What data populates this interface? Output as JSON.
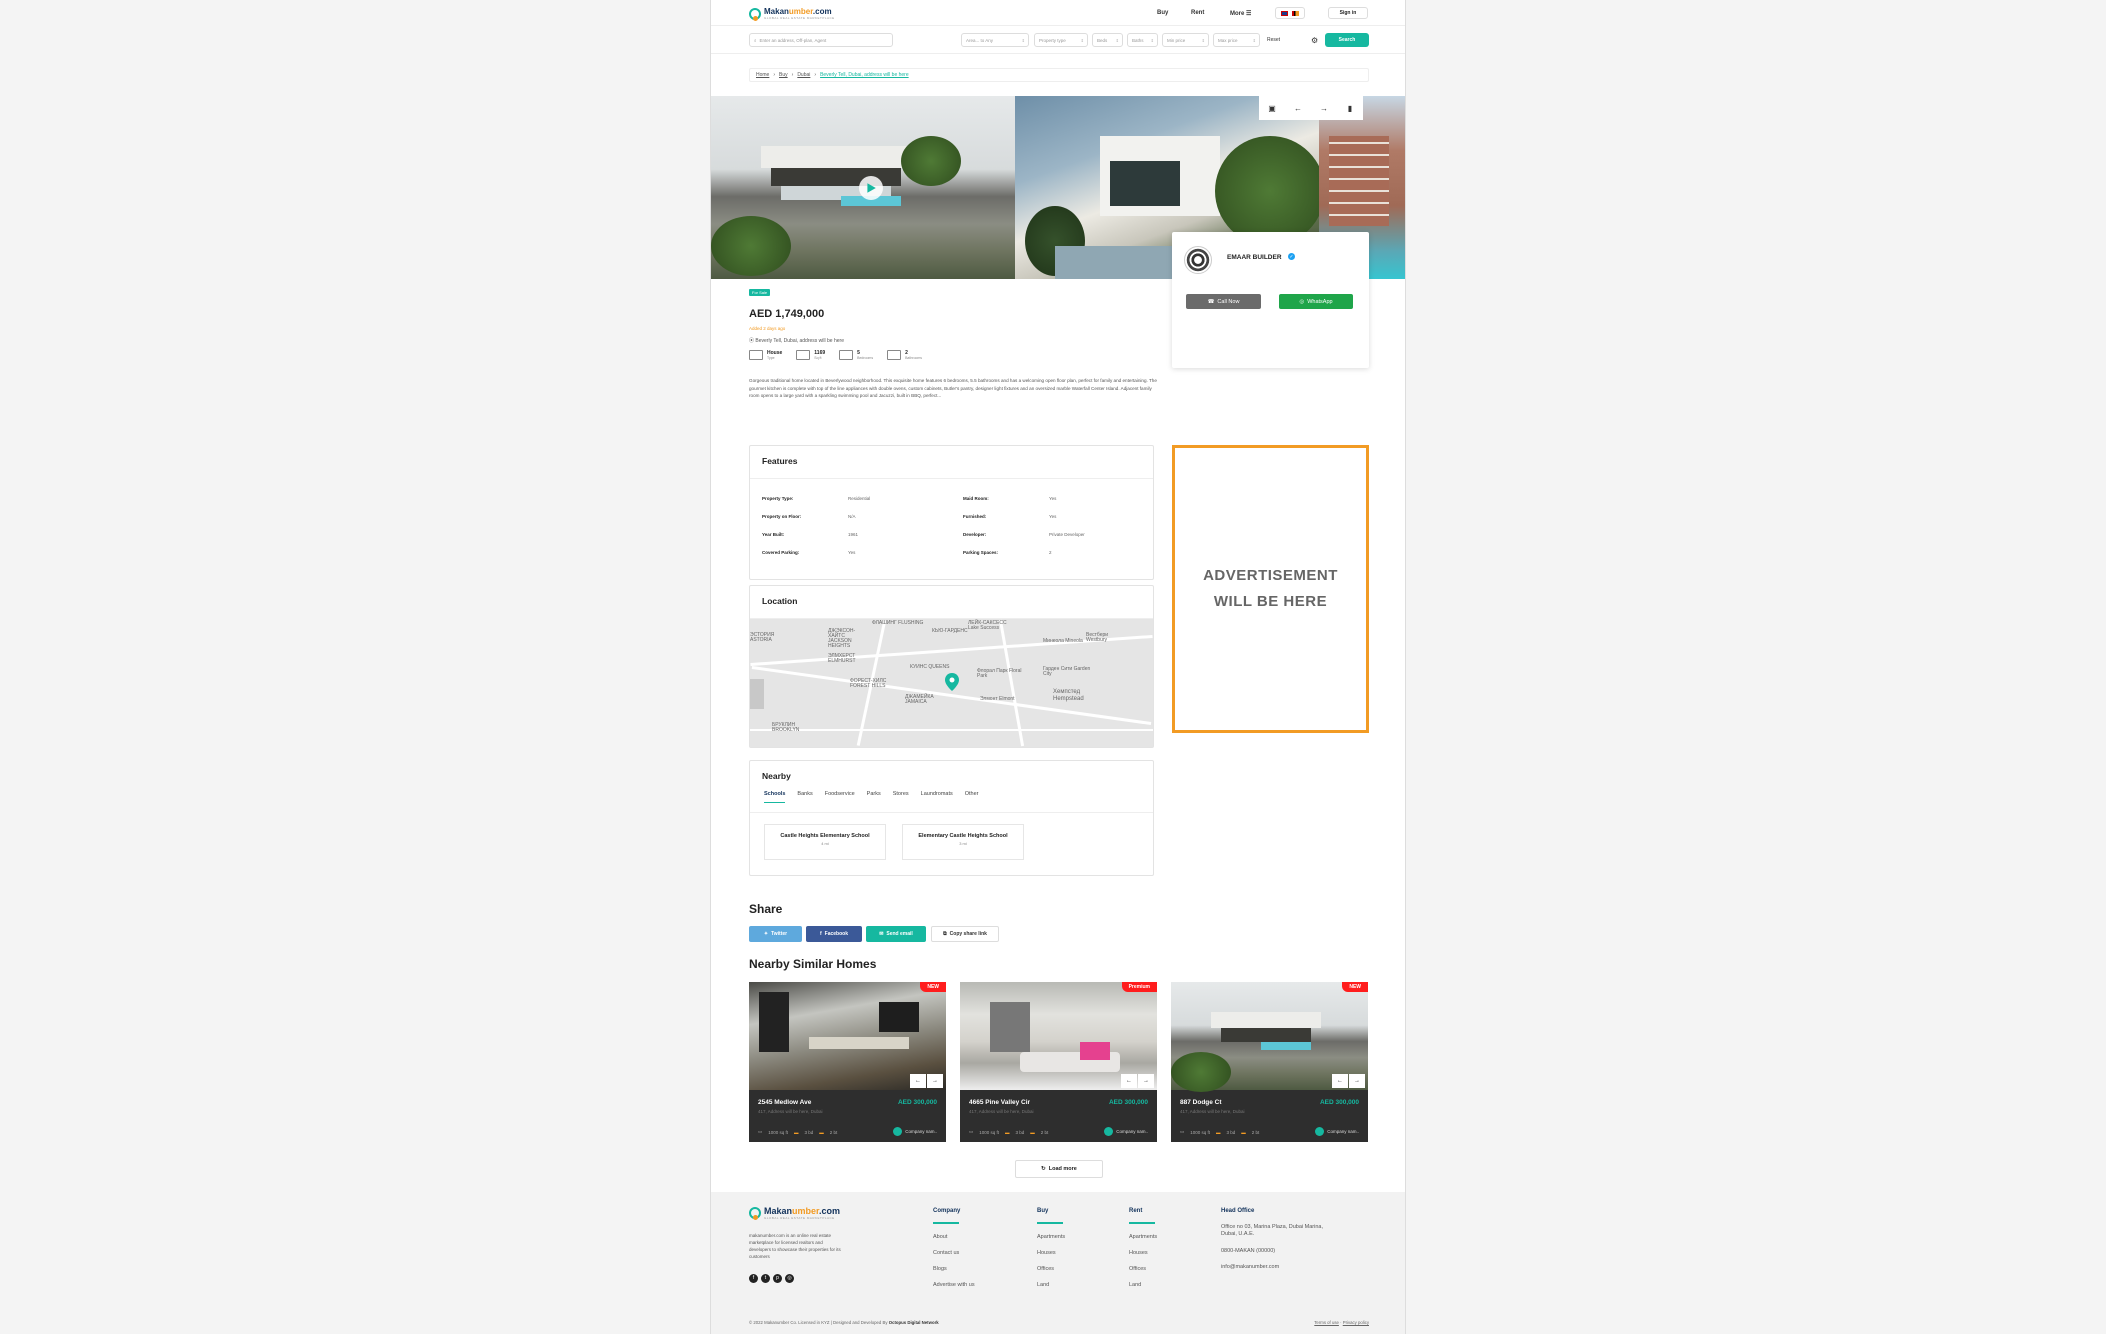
{
  "brand": {
    "name_part1": "Makan",
    "name_part2": "umber",
    "name_suffix": ".com",
    "tagline": "GLOBAL REAL ESTATE MARKETPLACE",
    "colors": {
      "teal": "#16b8a0",
      "orange": "#f29b24",
      "navy": "#12325b"
    }
  },
  "header": {
    "nav": [
      "Buy",
      "Rent",
      "More"
    ],
    "lang_flags": [
      "uk-flag-icon",
      "uae-flag-icon"
    ],
    "signin_label": "Sign in"
  },
  "search": {
    "placeholder": "Enter an address, Off-plan, Agent",
    "area": "Area...   to  Any",
    "property_type": "Property type",
    "beds": "Beds",
    "baths": "Baths",
    "min_price": "Min price",
    "max_price": "Max price",
    "reset_label": "Reset",
    "search_label": "Search"
  },
  "breadcrumb": [
    "Home",
    "Buy",
    "Dubai",
    "Beverly Tell, Dubai, address will be here"
  ],
  "agent": {
    "name": "EMAAR BUILDER",
    "call_label": "Call Now",
    "whatsapp_label": "WhatsApp"
  },
  "listing": {
    "status": "For Sale",
    "price": "AED 1,749,000",
    "posted": "Added 2 days ago",
    "address": "Beverly Tell, Dubai, address will be here",
    "specs": [
      {
        "value": "House",
        "label": "Type",
        "icon": "house-icon"
      },
      {
        "value": "1169",
        "label": "Sq ft",
        "icon": "area-icon"
      },
      {
        "value": "5",
        "label": "Bedrooms",
        "icon": "bed-icon"
      },
      {
        "value": "2",
        "label": "Bathrooms",
        "icon": "bath-icon"
      }
    ],
    "description": "Gorgeous traditional home located in Beverlywood neighborhood. This exquisite home features 6 bedrooms, 5.5 bathrooms and has a welcoming open floor plan, perfect for family and entertaining. The gourmet kitchen is complete with top of the line appliances with double ovens, custom cabinets, Butler's pantry, designer light fixtures and an oversized marble Waterfall Center Island. Adjacent family room opens to a large yard with a sparkling swimming pool and Jacuzzi, built in BBQ, perfect..."
  },
  "features": {
    "title": "Features",
    "left": [
      {
        "k": "Property Type:",
        "v": "Residential"
      },
      {
        "k": "Property on Floor:",
        "v": "N/A"
      },
      {
        "k": "Year Built:",
        "v": "1961"
      },
      {
        "k": "Covered Parking:",
        "v": "Yes"
      }
    ],
    "right": [
      {
        "k": "Maid Room:",
        "v": "Yes"
      },
      {
        "k": "Furnished:",
        "v": "Yes"
      },
      {
        "k": "Developer:",
        "v": "Private Developer"
      },
      {
        "k": "Parking Spaces:",
        "v": "2"
      }
    ]
  },
  "location": {
    "title": "Location",
    "map_labels": [
      "ФЛАШИНГ FLUSHING",
      "ДЖЭКСОН-ХАЙТС JACKSON HEIGHTS",
      "ЭЛМХЕРСТ ELMHURST",
      "КЬЮ-ГАРДЕНС",
      "ЛЕЙК-САКСЕСС Lake Success",
      "Минеола Mineola",
      "Вестбери Westbury",
      "КУИНС QUEENS",
      "Флорал Парк Floral Park",
      "Гарден Сити Garden City",
      "ФОРЕСТ-ХИЛС FOREST HILLS",
      "ДЖАМЕЙКА JAMAICA",
      "Элмонт Elmont",
      "Хемпстед Hempstead",
      "БРУКЛИН BROOKLYN",
      "ЭСТОРИЯ ASTORIA"
    ]
  },
  "ad": {
    "line1": "ADVERTISEMENT",
    "line2": "WILL BE HERE"
  },
  "nearby": {
    "title": "Nearby",
    "tabs": [
      "Schools",
      "Banks",
      "Foodservice",
      "Parks",
      "Stores",
      "Laundromats",
      "Other"
    ],
    "items": [
      {
        "name": "Castle Heights Elementary School",
        "dist": "4 mi"
      },
      {
        "name": "Elementary Castle Heights School",
        "dist": "3 mi"
      }
    ]
  },
  "share": {
    "title": "Share",
    "twitter": "Twitter",
    "facebook": "Facebook",
    "email": "Send email",
    "copy": "Copy share link"
  },
  "similar": {
    "title": "Nearby Similar Homes",
    "cards": [
      {
        "badge": "NEW",
        "title": "2545 Medlow Ave",
        "price": "AED 300,000",
        "address": "417, Address will be here, Dubai",
        "sqft": "1000 sq ft",
        "beds": "3 bd",
        "baths": "2 bt",
        "company": "Company nam.."
      },
      {
        "badge": "Premium",
        "title": "4665 Pine Valley Cir",
        "price": "AED 300,000",
        "address": "417, Address will be here, Dubai",
        "sqft": "1000 sq ft",
        "beds": "3 bd",
        "baths": "2 bt",
        "company": "Company nam.."
      },
      {
        "badge": "NEW",
        "title": "887 Dodge Ct",
        "price": "AED 300,000",
        "address": "417, Address will be here, Dubai",
        "sqft": "1000 sq ft",
        "beds": "3 bd",
        "baths": "2 bt",
        "company": "Company nam.."
      }
    ],
    "load_more": "Load more"
  },
  "footer": {
    "about": "makanumber.com is an online real estate marketplace for licensed realtors and developers to showcase their properties for its customers",
    "company": {
      "title": "Company",
      "items": [
        "About",
        "Contact us",
        "Blogs",
        "Advertise with us"
      ]
    },
    "buy": {
      "title": "Buy",
      "items": [
        "Apartments",
        "Houses",
        "Offices",
        "Land"
      ]
    },
    "rent": {
      "title": "Rent",
      "items": [
        "Apartments",
        "Houses",
        "Offices",
        "Land"
      ]
    },
    "office": {
      "title": "Head Office",
      "address": "Office no 03, Marina Plaza, Dubai Marina, Dubai, U.A.E.",
      "phone": "0800-MAKAN (00000)",
      "email": "info@makanumber.com"
    },
    "copyright": "© 2022 Makanumber Co. Licensed in KYZ  |  Designed and Developed By",
    "developer": "Octopus Digital Network",
    "terms": "Terms of use",
    "privacy": "Privacy policy"
  }
}
